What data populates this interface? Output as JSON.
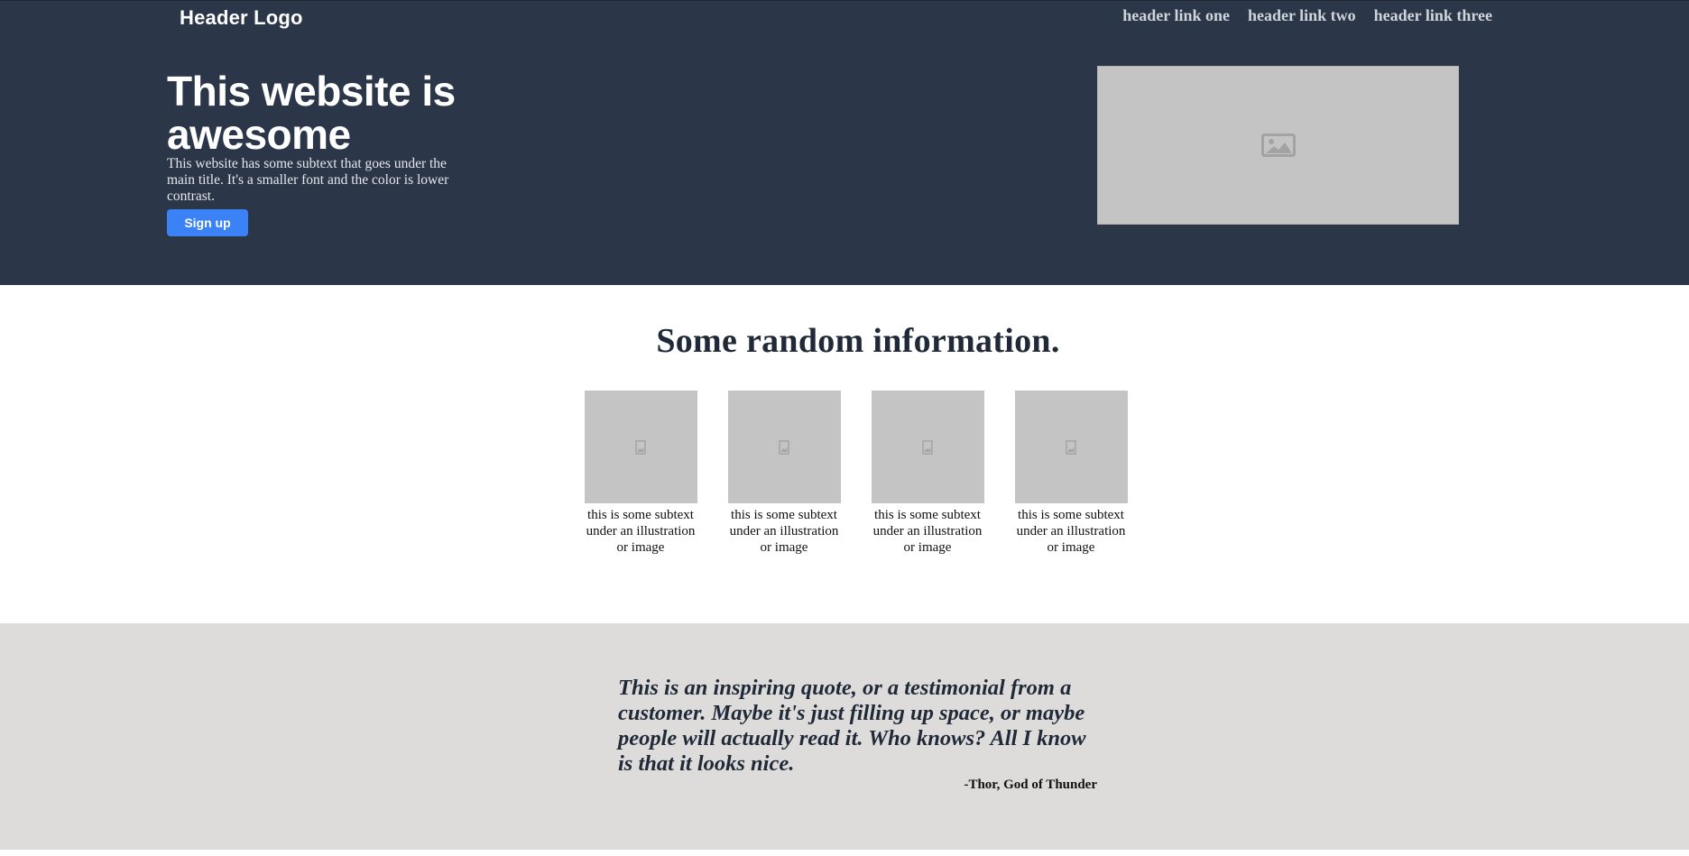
{
  "header": {
    "logo": "Header Logo",
    "links": [
      "header link one",
      "header link two",
      "header link three"
    ]
  },
  "hero": {
    "title": "This website is awesome",
    "subtext": "This website has some subtext that goes under the main title. It's a smaller font and the color is lower contrast.",
    "button_label": "Sign up",
    "image_icon": "image-placeholder-icon"
  },
  "info": {
    "title": "Some random information.",
    "cards": [
      {
        "text": "this is some subtext under an illustration or image"
      },
      {
        "text": "this is some subtext under an illustration or image"
      },
      {
        "text": "this is some subtext under an illustration or image"
      },
      {
        "text": "this is some subtext under an illustration or image"
      }
    ]
  },
  "quote": {
    "text": "This is an inspiring quote, or a testimonial from a customer. Maybe it's just filling up space, or maybe people will actually read it. Who knows? All I know is that it looks nice.",
    "author": "-Thor, God of Thunder"
  },
  "colors": {
    "header_bg": "#2b3649",
    "button": "#3b82f6",
    "placeholder": "#c4c4c4",
    "quote_bg": "#dedcdb"
  }
}
